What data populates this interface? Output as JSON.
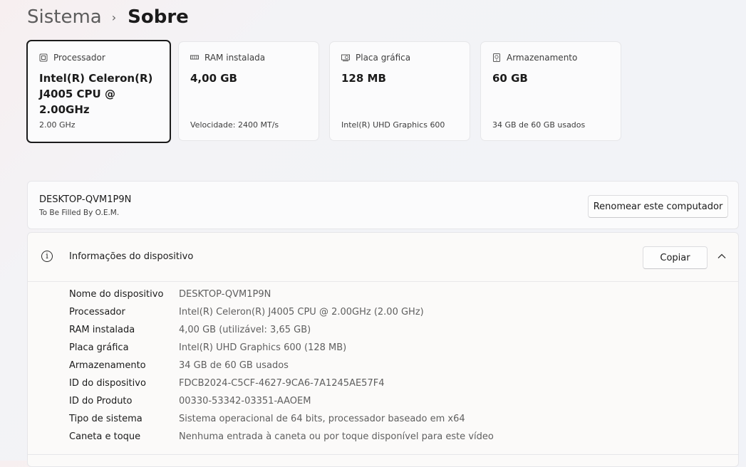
{
  "breadcrumb": {
    "parent": "Sistema",
    "separator": "›",
    "current": "Sobre"
  },
  "cards": [
    {
      "icon": "processor-icon",
      "title": "Processador",
      "value": "Intel(R) Celeron(R) J4005 CPU @ 2.00GHz",
      "footer": "2.00 GHz"
    },
    {
      "icon": "ram-icon",
      "title": "RAM instalada",
      "value": "4,00 GB",
      "footer": "Velocidade: 2400 MT/s"
    },
    {
      "icon": "graphics-card-icon",
      "title": "Placa gráfica",
      "value": "128 MB",
      "footer": "Intel(R) UHD Graphics 600"
    },
    {
      "icon": "storage-icon",
      "title": "Armazenamento",
      "value": "60 GB",
      "footer": "34 GB de 60 GB usados"
    }
  ],
  "computer": {
    "name": "DESKTOP-QVM1P9N",
    "subtitle": "To Be Filled By O.E.M.",
    "rename_label": "Renomear este computador"
  },
  "device_info": {
    "title": "Informações do dispositivo",
    "copy_label": "Copiar",
    "rows": [
      {
        "label": "Nome do dispositivo",
        "value": "DESKTOP-QVM1P9N"
      },
      {
        "label": "Processador",
        "value": "Intel(R) Celeron(R) J4005 CPU @ 2.00GHz (2.00 GHz)"
      },
      {
        "label": "RAM instalada",
        "value": "4,00 GB (utilizável: 3,65 GB)"
      },
      {
        "label": "Placa gráfica",
        "value": "Intel(R) UHD Graphics 600 (128 MB)"
      },
      {
        "label": "Armazenamento",
        "value": "34 GB de 60 GB usados"
      },
      {
        "label": "ID do dispositivo",
        "value": "FDCB2024-C5CF-4627-9CA6-7A1245AE57F4"
      },
      {
        "label": "ID do Produto",
        "value": "00330-53342-03351-AAOEM"
      },
      {
        "label": "Tipo de sistema",
        "value": "Sistema operacional de 64 bits, processador baseado em x64"
      },
      {
        "label": "Caneta e toque",
        "value": "Nenhuma entrada à caneta ou por toque disponível para este vídeo"
      }
    ]
  }
}
